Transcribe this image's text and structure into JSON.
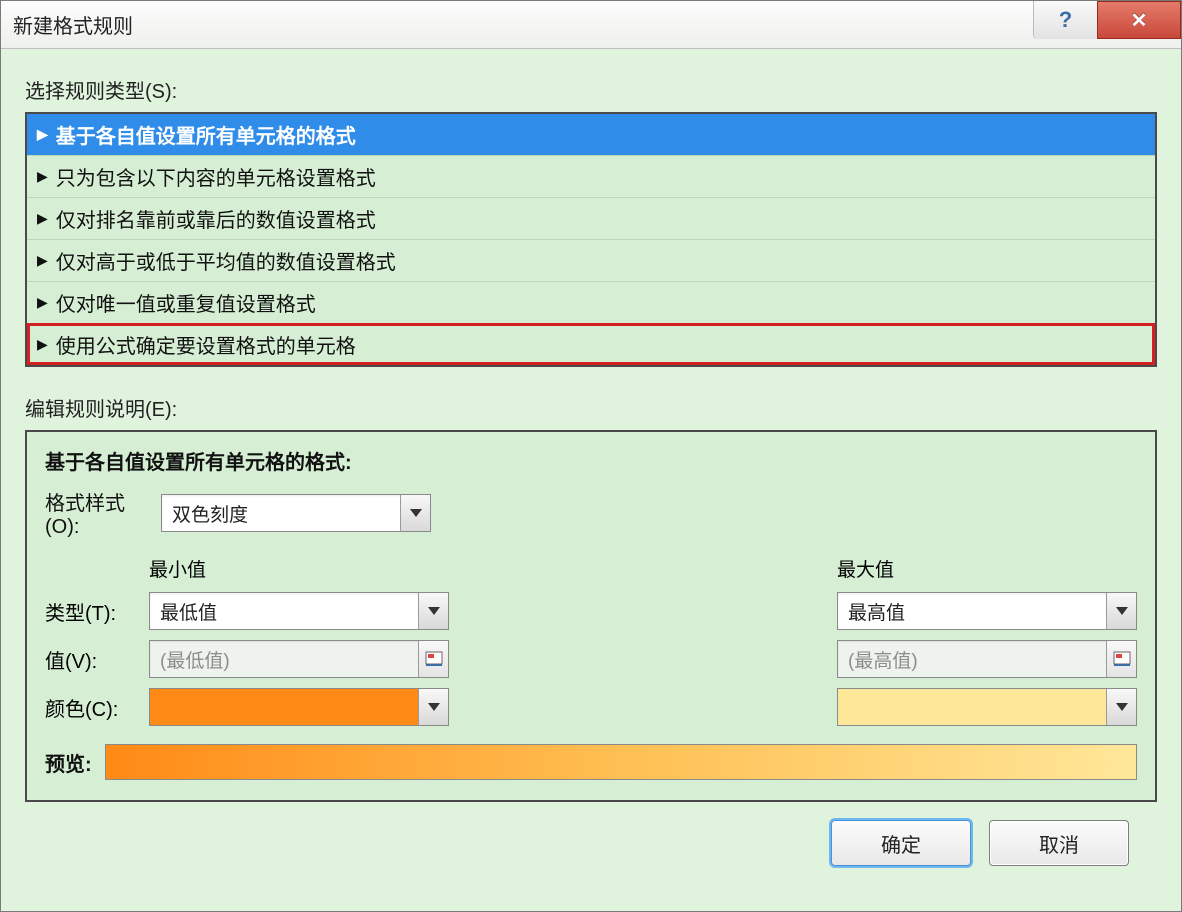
{
  "window": {
    "title": "新建格式规则",
    "help_symbol": "?",
    "close_symbol": "✕"
  },
  "ruleTypeLabel": "选择规则类型(S):",
  "ruleTypes": [
    {
      "label": "基于各自值设置所有单元格的格式",
      "selected": true,
      "highlight": false
    },
    {
      "label": "只为包含以下内容的单元格设置格式",
      "selected": false,
      "highlight": false
    },
    {
      "label": "仅对排名靠前或靠后的数值设置格式",
      "selected": false,
      "highlight": false
    },
    {
      "label": "仅对高于或低于平均值的数值设置格式",
      "selected": false,
      "highlight": false
    },
    {
      "label": "仅对唯一值或重复值设置格式",
      "selected": false,
      "highlight": false
    },
    {
      "label": "使用公式确定要设置格式的单元格",
      "selected": false,
      "highlight": true
    }
  ],
  "editDescLabel": "编辑规则说明(E):",
  "panel": {
    "title": "基于各自值设置所有单元格的格式:",
    "formatStyleLabel": "格式样式(O):",
    "formatStyleValue": "双色刻度",
    "minHeader": "最小值",
    "maxHeader": "最大值",
    "typeLabel": "类型(T):",
    "typeMin": "最低值",
    "typeMax": "最高值",
    "valueLabel": "值(V):",
    "valueMinPlaceholder": "(最低值)",
    "valueMaxPlaceholder": "(最高值)",
    "colorLabel": "颜色(C):",
    "colorMin": "#ff8a16",
    "colorMax": "#ffe79a",
    "previewLabel": "预览:"
  },
  "buttons": {
    "ok": "确定",
    "cancel": "取消"
  }
}
